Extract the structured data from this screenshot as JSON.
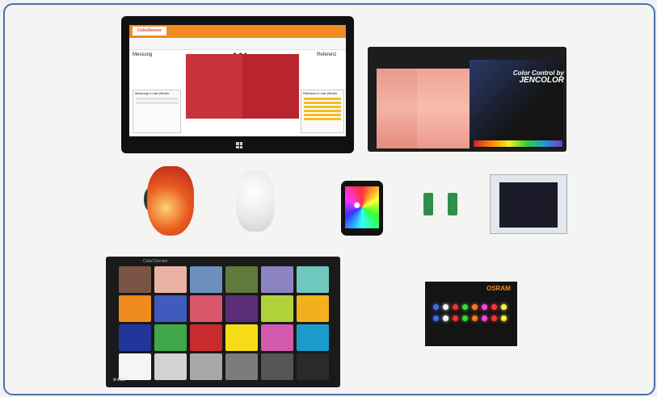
{
  "tablet_app": {
    "brand": "ColorSensor",
    "left_title": "Messung",
    "right_title": "Referenz",
    "reading": "6,94",
    "left_panel_header": "Messung in Lab-Werten",
    "right_panel_header": "Referenz in Lab-Werten"
  },
  "lightbox": {
    "title": "Color Control by",
    "brand": "JENCOLOR"
  },
  "color_checker": {
    "name": "ColorChecker",
    "brand": "x-rite",
    "patch_colors": [
      [
        "#7a5445",
        "#e8b3a5",
        "#6d8fbd",
        "#5f7a3a",
        "#8c84c0",
        "#6ec8bd"
      ],
      [
        "#ef8a1c",
        "#3f5bbd",
        "#d8566a",
        "#5c2e78",
        "#b2d23c",
        "#f2b01f"
      ],
      [
        "#22359a",
        "#40a84a",
        "#c72b2e",
        "#f6dc16",
        "#d35aae",
        "#1b9bcb"
      ],
      [
        "#f5f5f5",
        "#d2d2d2",
        "#a8a8a8",
        "#7c7c7c",
        "#555555",
        "#2a2a2a"
      ]
    ]
  },
  "led_card": {
    "brand": "OSRAM",
    "led_colors": [
      "#3a6df0",
      "#f4f4ff",
      "#e33",
      "#3d3",
      "#f72",
      "#f4d",
      "#f33",
      "#fe4"
    ]
  }
}
